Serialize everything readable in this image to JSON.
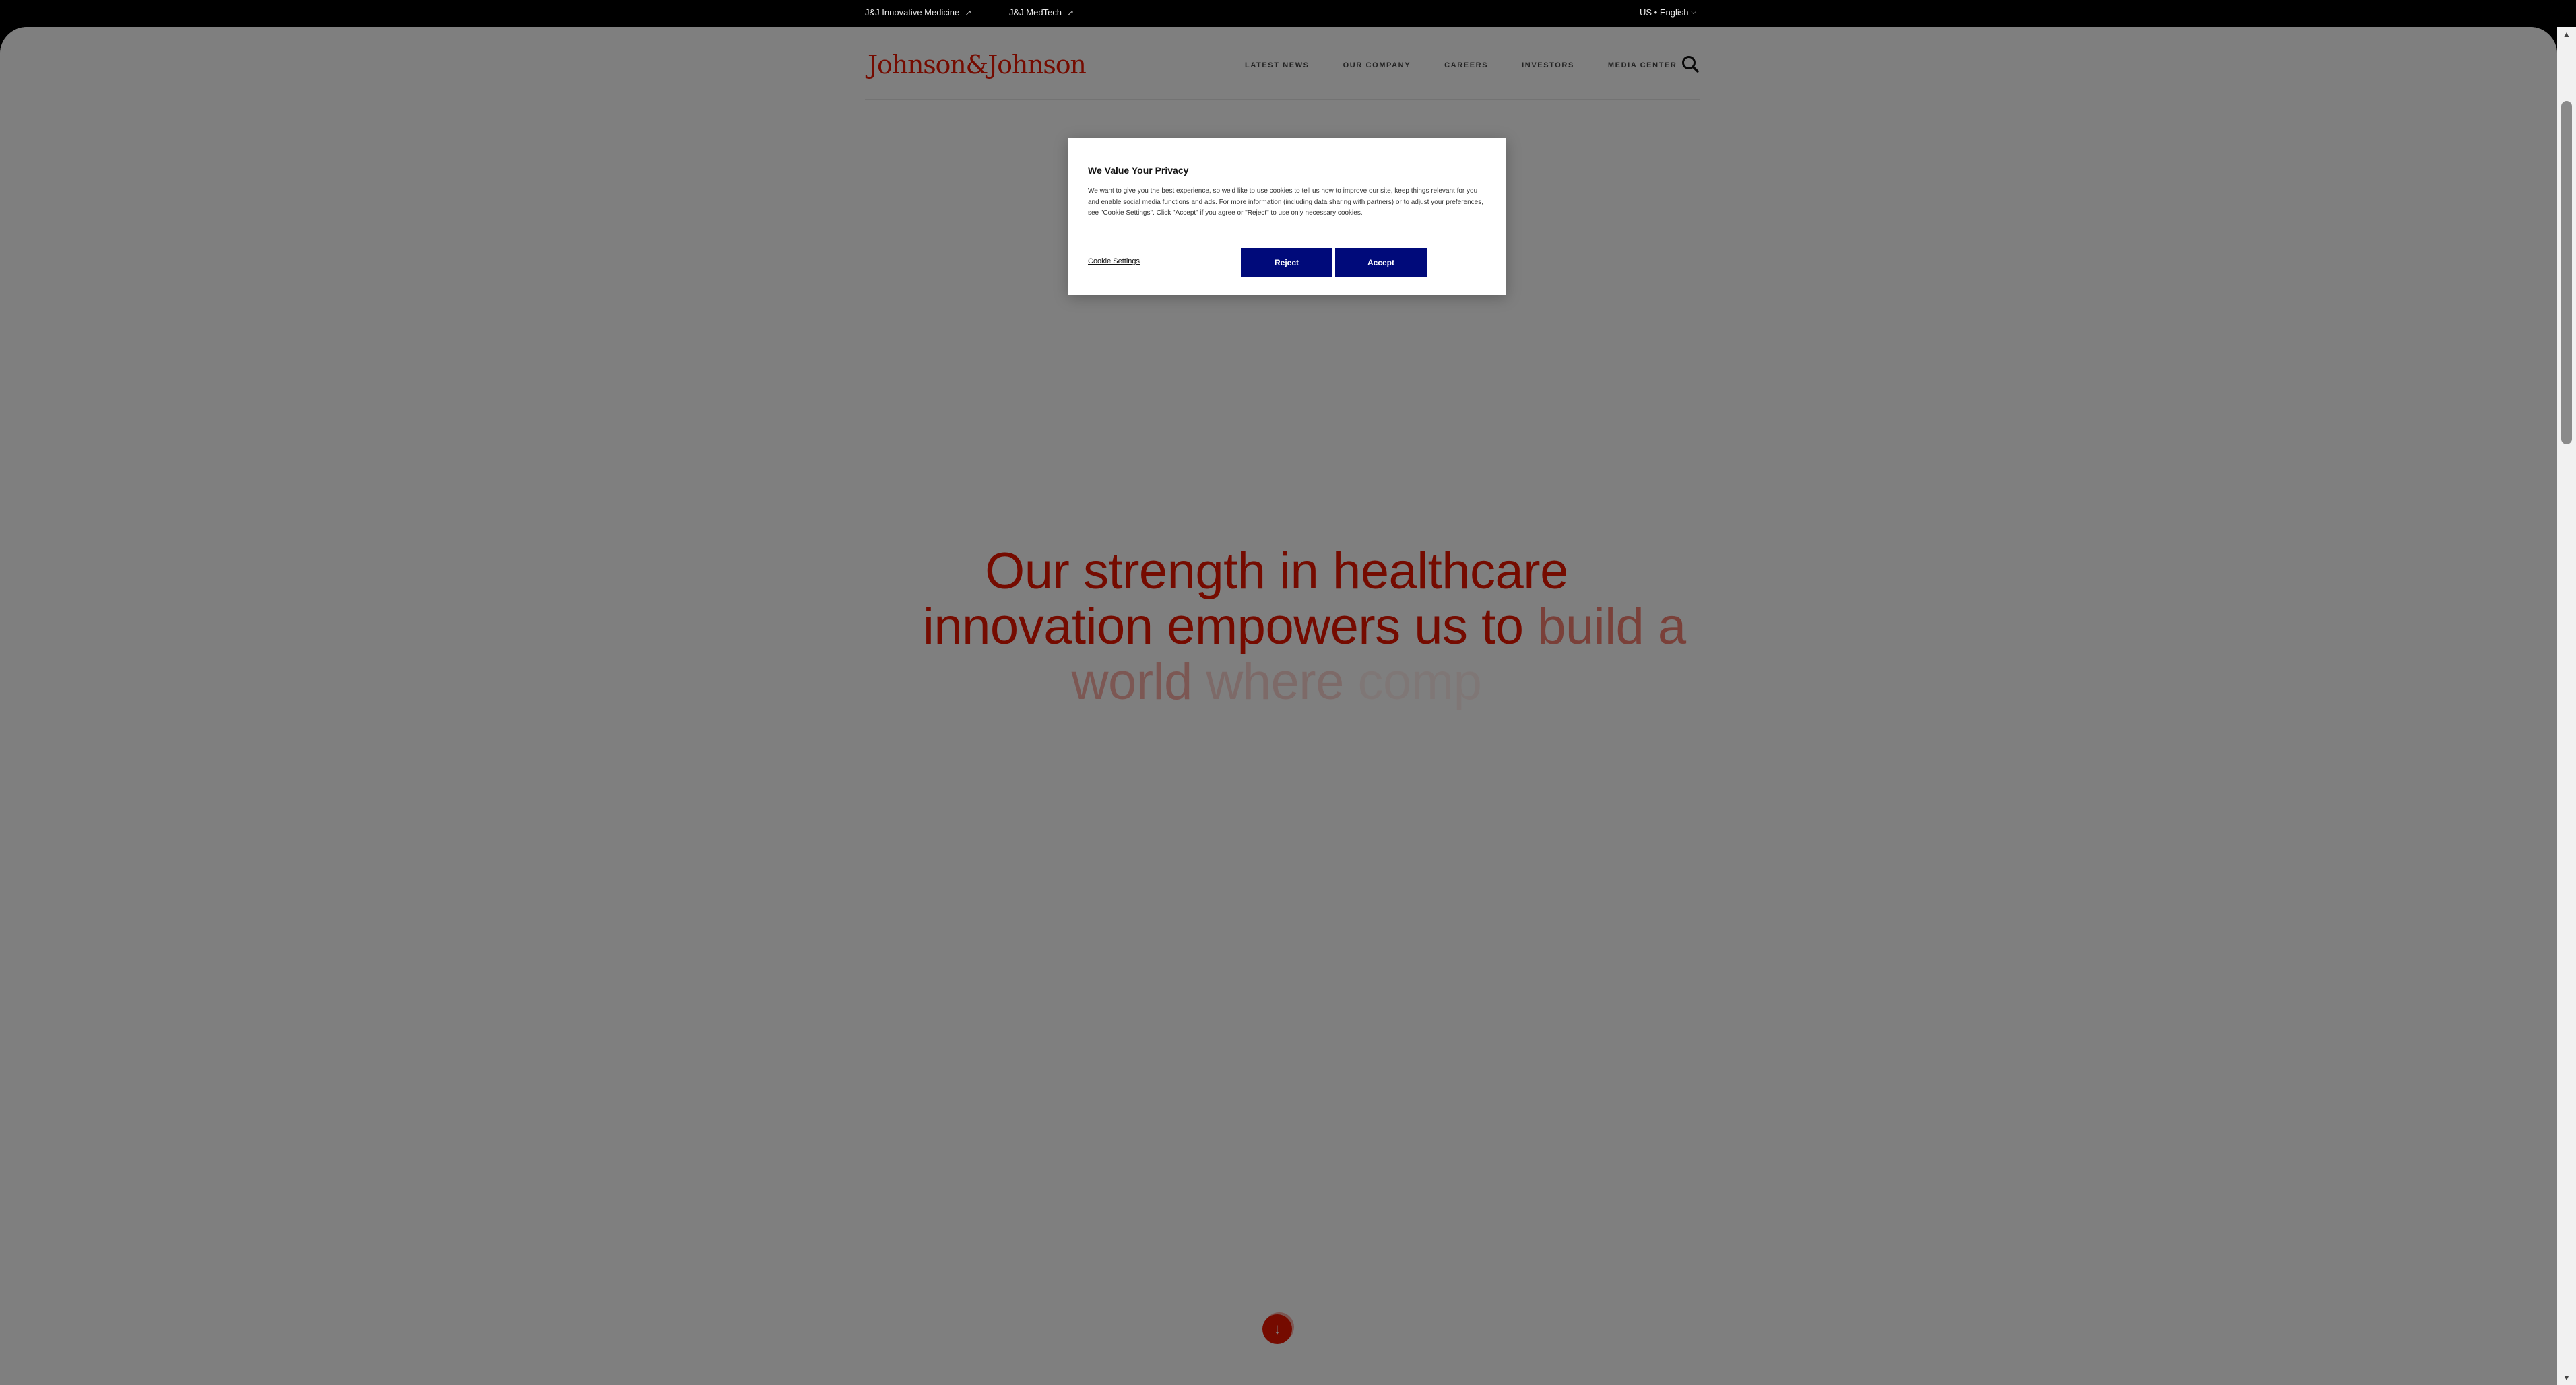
{
  "utility_bar": {
    "links": [
      {
        "label": "J&J Innovative Medicine",
        "icon": "external-link-icon"
      },
      {
        "label": "J&J MedTech",
        "icon": "external-link-icon"
      }
    ],
    "locale": "US • English",
    "locale_icon": "chevron-down-icon"
  },
  "header": {
    "logo": "Johnson&Johnson",
    "nav": [
      "LATEST NEWS",
      "OUR COMPANY",
      "CAREERS",
      "INVESTORS",
      "MEDIA CENTER"
    ],
    "search_icon": "search-icon"
  },
  "hero": {
    "line1": "Our strength in healthcare",
    "line2_main": "innovation empowers us to",
    "line2_fade": "build a",
    "line3_a": "world",
    "line3_b": "where",
    "line3_c": "comp"
  },
  "scroll_button": {
    "icon": "arrow-down-icon",
    "glyph": "↓"
  },
  "cookie": {
    "title": "We Value Your Privacy",
    "text": "We want to give you the best experience, so we'd like to use cookies to tell us how to improve our site, keep things relevant for you and enable social media functions and ads. For more information (including data sharing with partners) or to adjust your preferences, see \"Cookie Settings\". Click \"Accept\" if you agree or \"Reject\" to use only necessary cookies.",
    "settings_label": "Cookie Settings",
    "reject_label": "Reject",
    "accept_label": "Accept",
    "button_color": "#000a7a"
  },
  "colors": {
    "brand_red": "#eb1700"
  }
}
